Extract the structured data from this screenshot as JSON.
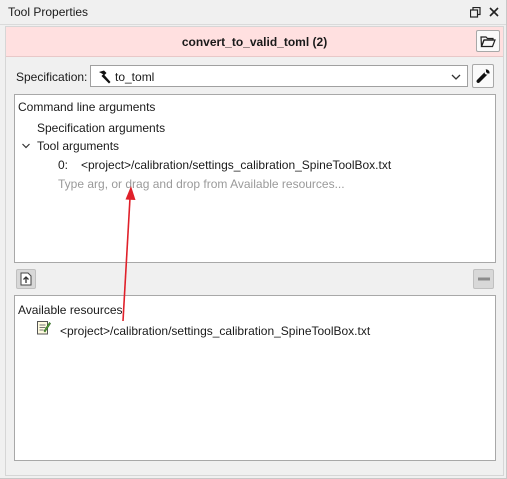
{
  "window": {
    "title": "Tool Properties",
    "float_icon": "float-icon",
    "close_icon": "close-icon"
  },
  "item": {
    "name": "convert_to_valid_toml (2)",
    "open_folder_icon": "folder-open-icon"
  },
  "specification": {
    "label": "Specification:",
    "value": "to_toml",
    "value_icon": "hammer-icon",
    "dropdown_icon": "chevron-down-icon",
    "edit_icon": "wrench-icon"
  },
  "command_line": {
    "header": "Command line arguments",
    "spec_args_label": "Specification arguments",
    "tool_args_label": "Tool arguments",
    "args": [
      {
        "index": "0:",
        "value": "<project>/calibration/settings_calibration_SpineToolBox.txt"
      }
    ],
    "placeholder": "Type arg, or drag and drop from Available resources..."
  },
  "toolbar": {
    "add_arg_icon": "add-arg-icon",
    "remove_arg_icon": "minus-icon"
  },
  "available_resources": {
    "header": "Available resources",
    "items": [
      {
        "icon": "text-file-icon",
        "label": "<project>/calibration/settings_calibration_SpineToolBox.txt"
      }
    ]
  },
  "colors": {
    "name_bar": "#ffe0e0",
    "arrow": "#e0202a"
  }
}
